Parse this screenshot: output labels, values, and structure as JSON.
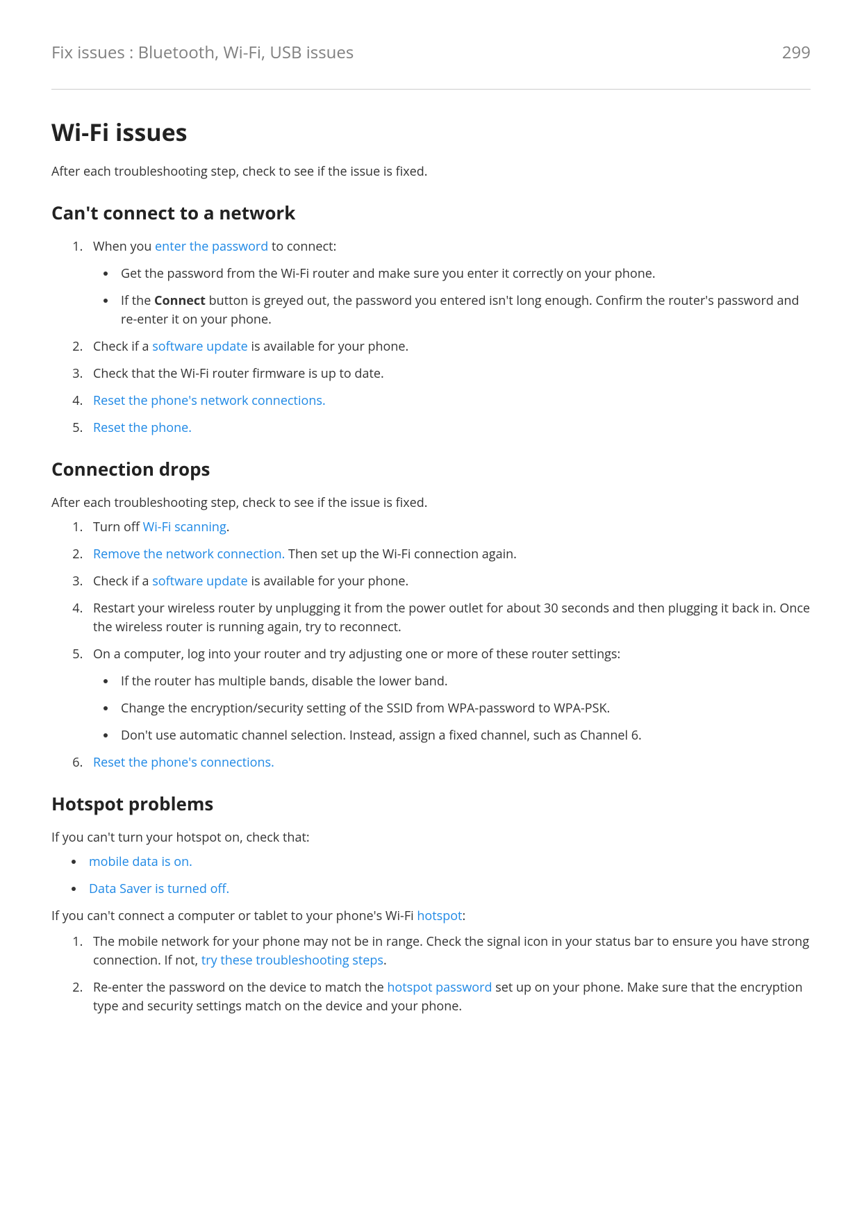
{
  "header": {
    "title": "Fix issues : Bluetooth, Wi-Fi, USB issues",
    "pageNumber": "299"
  },
  "h1": "Wi-Fi issues",
  "intro": "After each troubleshooting step, check to see if the issue is fixed.",
  "s1": {
    "title": "Can't connect to a network",
    "li1a": "When you ",
    "li1link": "enter the password",
    "li1b": " to connect:",
    "li1b1": "Get the password from the Wi-Fi router and make sure you enter it correctly on your phone.",
    "li1b2a": "If the ",
    "li1b2s": "Connect",
    "li1b2b": " button is greyed out, the password you entered isn't long enough. Confirm the router's password and re-enter it on your phone.",
    "li2a": "Check if a ",
    "li2link": "software update",
    "li2b": " is available for your phone.",
    "li3": "Check that the Wi-Fi router firmware is up to date.",
    "li4": "Reset the phone's network connections.",
    "li5": "Reset the phone."
  },
  "s2": {
    "title": "Connection drops",
    "intro": "After each troubleshooting step, check to see if the issue is fixed.",
    "li1a": "Turn off ",
    "li1link": "Wi-Fi scanning",
    "li1b": ".",
    "li2link": "Remove the network connection.",
    "li2b": " Then set up the Wi-Fi connection again.",
    "li3a": "Check if a ",
    "li3link": "software update",
    "li3b": " is available for your phone.",
    "li4": "Restart your wireless router by unplugging it from the power outlet for about 30 seconds and then plugging it back in. Once the wireless router is running again, try to reconnect.",
    "li5": "On a computer, log into your router and try adjusting one or more of these router settings:",
    "li5b1": "If the router has multiple bands, disable the lower band.",
    "li5b2": "Change the encryption/security setting of the SSID from WPA-password to WPA-PSK.",
    "li5b3": "Don't use automatic channel selection. Instead, assign a fixed channel, such as Channel 6.",
    "li6": "Reset the phone's connections."
  },
  "s3": {
    "title": "Hotspot problems",
    "intro": "If you can't turn your hotspot on, check that:",
    "bul1": "mobile data is on.",
    "bul2": "Data Saver is turned off.",
    "p2a": "If you can't connect a computer or tablet to your phone's Wi-Fi ",
    "p2link": "hotspot",
    "p2b": ":",
    "li1a": "The mobile network for your phone may not be in range. Check the signal icon in your status bar to ensure you have strong connection. If not, ",
    "li1link": "try these troubleshooting steps",
    "li1b": ".",
    "li2a": "Re-enter the password on the device to match the ",
    "li2link": "hotspot password",
    "li2b": " set up on your phone. Make sure that the encryption type and security settings match on the device and your phone."
  }
}
